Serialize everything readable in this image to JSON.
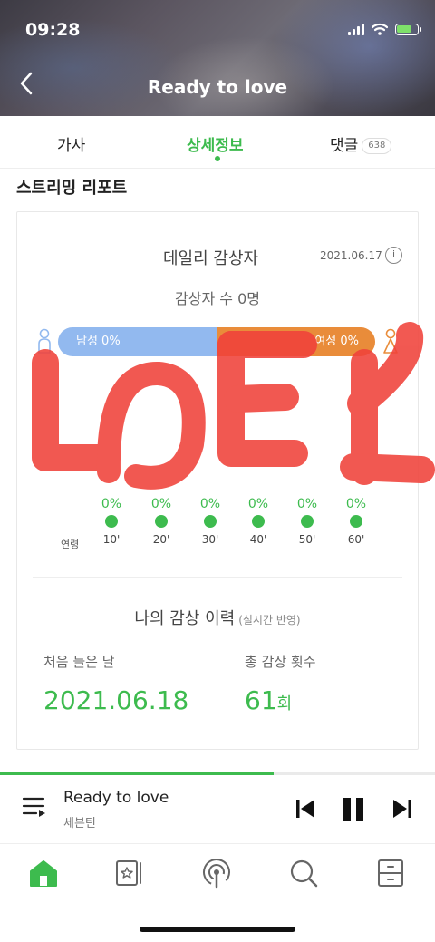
{
  "status_bar": {
    "time": "09:28"
  },
  "header": {
    "title": "Ready to love"
  },
  "tabs": [
    {
      "label": "가사"
    },
    {
      "label": "상세정보"
    },
    {
      "label": "댓글",
      "badge": "638"
    }
  ],
  "section_title": "스트리밍 리포트",
  "daily": {
    "title": "데일리 감상자",
    "date": "2021.06.17",
    "info_icon": "i",
    "listener_count": "감상자 수 0명",
    "male": "남성 0%",
    "female": "여성 0%",
    "male_share": 0.5,
    "female_share": 0.5,
    "age_label": "연령",
    "ages": [
      {
        "age": "10'",
        "pct": "0%"
      },
      {
        "age": "20'",
        "pct": "0%"
      },
      {
        "age": "30'",
        "pct": "0%"
      },
      {
        "age": "40'",
        "pct": "0%"
      },
      {
        "age": "50'",
        "pct": "0%"
      },
      {
        "age": "60'",
        "pct": "0%"
      }
    ]
  },
  "history": {
    "title": "나의 감상 이력",
    "sub": "(실시간 반영)",
    "first_label": "처음 들은 날",
    "first_date": "2021.06.18",
    "total_label": "총 감상 횟수",
    "total_value": "61",
    "total_unit": "회"
  },
  "overlay_text": "LOVE",
  "player": {
    "title": "Ready to love",
    "artist": "세븐틴",
    "progress": 0.63
  },
  "nav": {
    "items": [
      "home-icon",
      "library-icon",
      "podcast-icon",
      "search-icon",
      "storage-icon"
    ],
    "active": "home-icon"
  },
  "colors": {
    "accent": "#3dbb4e",
    "male_bar": "#92b9ef",
    "female_bar": "#e98c3a",
    "overlay": "#f0423a"
  }
}
